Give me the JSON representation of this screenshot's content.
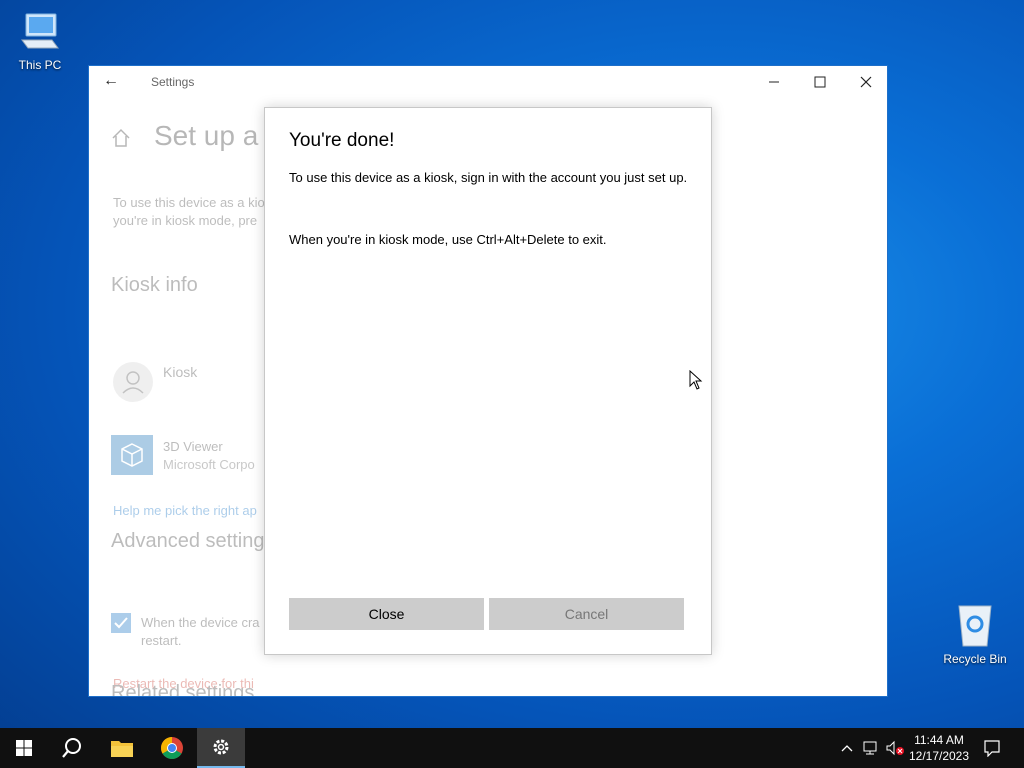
{
  "desktop": {
    "icons": [
      {
        "label": "This PC"
      },
      {
        "label": "Recycle Bin"
      }
    ]
  },
  "window": {
    "title": "Settings",
    "page_heading": "Set up a k",
    "intro_line1": "To use this device as a kio",
    "intro_line2": "you're in kiosk mode, pre",
    "kiosk_info_heading": "Kiosk info",
    "account_name": "Kiosk",
    "app_name": "3D Viewer",
    "app_publisher": "Microsoft Corpo",
    "help_link": "Help me pick the right ap",
    "advanced_heading": "Advanced setting",
    "checkbox_line1": "When the device cra",
    "checkbox_line2": "restart.",
    "restart_link": "Restart the device for thi",
    "related_heading": "Related settings"
  },
  "dialog": {
    "title": "You're done!",
    "body1": "To use this device as a kiosk, sign in with the account you just set up.",
    "body2": "When you're in kiosk mode, use Ctrl+Alt+Delete to exit.",
    "close_label": "Close",
    "cancel_label": "Cancel"
  },
  "taskbar": {
    "items": [
      "start-icon",
      "search-icon",
      "file-explorer-icon",
      "chrome-icon",
      "settings-icon"
    ],
    "time": "11:44 AM",
    "date": "12/17/2023"
  },
  "colors": {
    "accent": "#0067c0",
    "taskbar": "#101010",
    "desktop": "#0a6fd6"
  }
}
